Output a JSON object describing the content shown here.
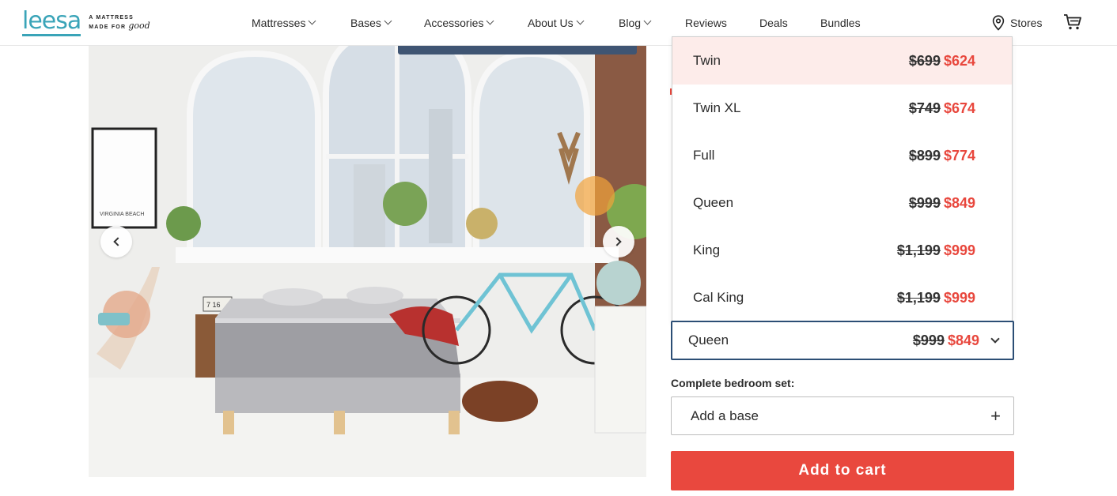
{
  "logo": {
    "word": "leesa",
    "tag_line1": "A MATTRESS",
    "tag_line2": "MADE FOR",
    "tag_script": "good"
  },
  "nav": {
    "items": [
      {
        "label": "Mattresses",
        "dropdown": true
      },
      {
        "label": "Bases",
        "dropdown": true
      },
      {
        "label": "Accessories",
        "dropdown": true
      },
      {
        "label": "About Us",
        "dropdown": true
      },
      {
        "label": "Blog",
        "dropdown": true
      },
      {
        "label": "Reviews",
        "dropdown": false
      },
      {
        "label": "Deals",
        "dropdown": false
      },
      {
        "label": "Bundles",
        "dropdown": false
      }
    ],
    "stores_label": "Stores",
    "stores_icon": "map-pin-icon",
    "cart_icon": "cart-icon"
  },
  "gallery": {
    "prev_icon": "chevron-left-icon",
    "next_icon": "chevron-right-icon",
    "poster_text": "VIRGINIA BEACH",
    "clock_text": "7 16"
  },
  "size_options": [
    {
      "size": "Twin",
      "old_price": "$699",
      "new_price": "$624",
      "highlighted": true
    },
    {
      "size": "Twin XL",
      "old_price": "$749",
      "new_price": "$674",
      "highlighted": false
    },
    {
      "size": "Full",
      "old_price": "$899",
      "new_price": "$774",
      "highlighted": false
    },
    {
      "size": "Queen",
      "old_price": "$999",
      "new_price": "$849",
      "highlighted": false
    },
    {
      "size": "King",
      "old_price": "$1,199",
      "new_price": "$999",
      "highlighted": false
    },
    {
      "size": "Cal King",
      "old_price": "$1,199",
      "new_price": "$999",
      "highlighted": false
    }
  ],
  "selected": {
    "size": "Queen",
    "old_price": "$999",
    "new_price": "$849"
  },
  "bedroom_set": {
    "label": "Complete bedroom set:",
    "placeholder": "Add a base",
    "add_symbol": "+"
  },
  "add_to_cart": "Add to cart",
  "colors": {
    "accent": "#e9483e",
    "brand": "#3aa4b8",
    "select_border": "#2c4e75",
    "highlight": "#fdecea"
  }
}
